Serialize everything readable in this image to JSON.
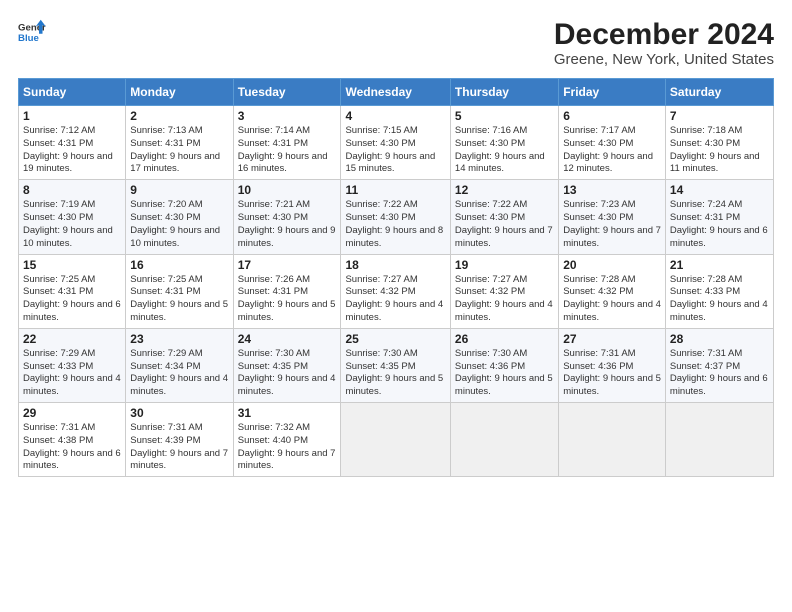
{
  "header": {
    "logo_line1": "General",
    "logo_line2": "Blue",
    "title": "December 2024",
    "subtitle": "Greene, New York, United States"
  },
  "days_of_week": [
    "Sunday",
    "Monday",
    "Tuesday",
    "Wednesday",
    "Thursday",
    "Friday",
    "Saturday"
  ],
  "weeks": [
    [
      {
        "day": "1",
        "sunrise": "7:12 AM",
        "sunset": "4:31 PM",
        "daylight_hours": "9",
        "daylight_minutes": "19"
      },
      {
        "day": "2",
        "sunrise": "7:13 AM",
        "sunset": "4:31 PM",
        "daylight_hours": "9",
        "daylight_minutes": "17"
      },
      {
        "day": "3",
        "sunrise": "7:14 AM",
        "sunset": "4:31 PM",
        "daylight_hours": "9",
        "daylight_minutes": "16"
      },
      {
        "day": "4",
        "sunrise": "7:15 AM",
        "sunset": "4:30 PM",
        "daylight_hours": "9",
        "daylight_minutes": "15"
      },
      {
        "day": "5",
        "sunrise": "7:16 AM",
        "sunset": "4:30 PM",
        "daylight_hours": "9",
        "daylight_minutes": "14"
      },
      {
        "day": "6",
        "sunrise": "7:17 AM",
        "sunset": "4:30 PM",
        "daylight_hours": "9",
        "daylight_minutes": "12"
      },
      {
        "day": "7",
        "sunrise": "7:18 AM",
        "sunset": "4:30 PM",
        "daylight_hours": "9",
        "daylight_minutes": "11"
      }
    ],
    [
      {
        "day": "8",
        "sunrise": "7:19 AM",
        "sunset": "4:30 PM",
        "daylight_hours": "9",
        "daylight_minutes": "10"
      },
      {
        "day": "9",
        "sunrise": "7:20 AM",
        "sunset": "4:30 PM",
        "daylight_hours": "9",
        "daylight_minutes": "10"
      },
      {
        "day": "10",
        "sunrise": "7:21 AM",
        "sunset": "4:30 PM",
        "daylight_hours": "9",
        "daylight_minutes": "9"
      },
      {
        "day": "11",
        "sunrise": "7:22 AM",
        "sunset": "4:30 PM",
        "daylight_hours": "9",
        "daylight_minutes": "8"
      },
      {
        "day": "12",
        "sunrise": "7:22 AM",
        "sunset": "4:30 PM",
        "daylight_hours": "9",
        "daylight_minutes": "7"
      },
      {
        "day": "13",
        "sunrise": "7:23 AM",
        "sunset": "4:30 PM",
        "daylight_hours": "9",
        "daylight_minutes": "7"
      },
      {
        "day": "14",
        "sunrise": "7:24 AM",
        "sunset": "4:31 PM",
        "daylight_hours": "9",
        "daylight_minutes": "6"
      }
    ],
    [
      {
        "day": "15",
        "sunrise": "7:25 AM",
        "sunset": "4:31 PM",
        "daylight_hours": "9",
        "daylight_minutes": "6"
      },
      {
        "day": "16",
        "sunrise": "7:25 AM",
        "sunset": "4:31 PM",
        "daylight_hours": "9",
        "daylight_minutes": "5"
      },
      {
        "day": "17",
        "sunrise": "7:26 AM",
        "sunset": "4:31 PM",
        "daylight_hours": "9",
        "daylight_minutes": "5"
      },
      {
        "day": "18",
        "sunrise": "7:27 AM",
        "sunset": "4:32 PM",
        "daylight_hours": "9",
        "daylight_minutes": "4"
      },
      {
        "day": "19",
        "sunrise": "7:27 AM",
        "sunset": "4:32 PM",
        "daylight_hours": "9",
        "daylight_minutes": "4"
      },
      {
        "day": "20",
        "sunrise": "7:28 AM",
        "sunset": "4:32 PM",
        "daylight_hours": "9",
        "daylight_minutes": "4"
      },
      {
        "day": "21",
        "sunrise": "7:28 AM",
        "sunset": "4:33 PM",
        "daylight_hours": "9",
        "daylight_minutes": "4"
      }
    ],
    [
      {
        "day": "22",
        "sunrise": "7:29 AM",
        "sunset": "4:33 PM",
        "daylight_hours": "9",
        "daylight_minutes": "4"
      },
      {
        "day": "23",
        "sunrise": "7:29 AM",
        "sunset": "4:34 PM",
        "daylight_hours": "9",
        "daylight_minutes": "4"
      },
      {
        "day": "24",
        "sunrise": "7:30 AM",
        "sunset": "4:35 PM",
        "daylight_hours": "9",
        "daylight_minutes": "4"
      },
      {
        "day": "25",
        "sunrise": "7:30 AM",
        "sunset": "4:35 PM",
        "daylight_hours": "9",
        "daylight_minutes": "5"
      },
      {
        "day": "26",
        "sunrise": "7:30 AM",
        "sunset": "4:36 PM",
        "daylight_hours": "9",
        "daylight_minutes": "5"
      },
      {
        "day": "27",
        "sunrise": "7:31 AM",
        "sunset": "4:36 PM",
        "daylight_hours": "9",
        "daylight_minutes": "5"
      },
      {
        "day": "28",
        "sunrise": "7:31 AM",
        "sunset": "4:37 PM",
        "daylight_hours": "9",
        "daylight_minutes": "6"
      }
    ],
    [
      {
        "day": "29",
        "sunrise": "7:31 AM",
        "sunset": "4:38 PM",
        "daylight_hours": "9",
        "daylight_minutes": "6"
      },
      {
        "day": "30",
        "sunrise": "7:31 AM",
        "sunset": "4:39 PM",
        "daylight_hours": "9",
        "daylight_minutes": "7"
      },
      {
        "day": "31",
        "sunrise": "7:32 AM",
        "sunset": "4:40 PM",
        "daylight_hours": "9",
        "daylight_minutes": "7"
      },
      null,
      null,
      null,
      null
    ]
  ]
}
